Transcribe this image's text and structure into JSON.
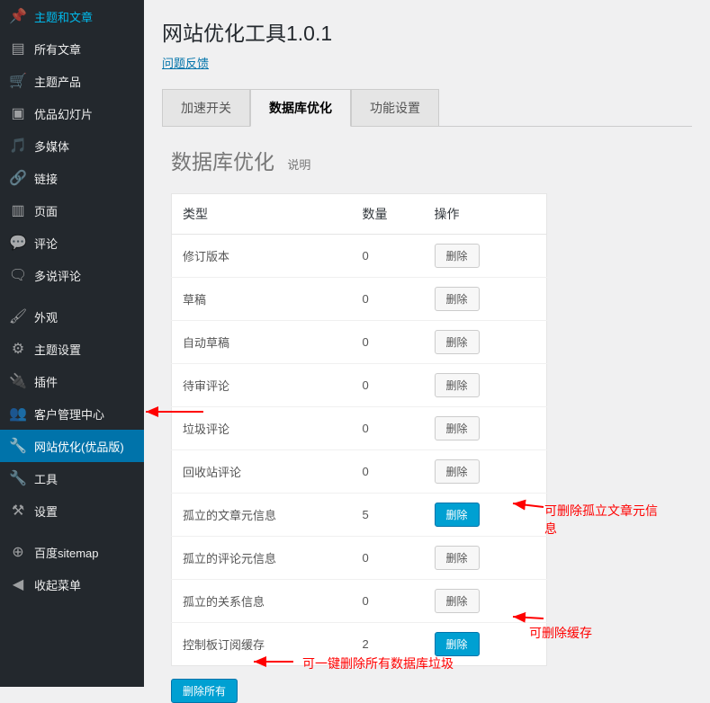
{
  "sidebar": {
    "items": [
      {
        "label": "主题和文章",
        "icon": "pin"
      },
      {
        "label": "所有文章",
        "icon": "list"
      },
      {
        "label": "主题产品",
        "icon": "cart"
      },
      {
        "label": "优品幻灯片",
        "icon": "slide"
      },
      {
        "label": "多媒体",
        "icon": "media"
      },
      {
        "label": "链接",
        "icon": "link"
      },
      {
        "label": "页面",
        "icon": "page"
      },
      {
        "label": "评论",
        "icon": "comment"
      },
      {
        "label": "多说评论",
        "icon": "chat"
      },
      {
        "label": "外观",
        "icon": "brush"
      },
      {
        "label": "主题设置",
        "icon": "gear"
      },
      {
        "label": "插件",
        "icon": "plugin"
      },
      {
        "label": "客户管理中心",
        "icon": "users"
      },
      {
        "label": "网站优化(优品版)",
        "icon": "wrench"
      },
      {
        "label": "工具",
        "icon": "wrench2"
      },
      {
        "label": "设置",
        "icon": "sliders"
      },
      {
        "label": "百度sitemap",
        "icon": "baidu"
      },
      {
        "label": "收起菜单",
        "icon": "collapse"
      }
    ],
    "active_index": 13
  },
  "header": {
    "title": "网站优化工具1.0.1",
    "feedback": "问题反馈"
  },
  "tabs": [
    {
      "label": "加速开关"
    },
    {
      "label": "数据库优化"
    },
    {
      "label": "功能设置"
    }
  ],
  "active_tab": 1,
  "section": {
    "title": "数据库优化",
    "hint": "说明"
  },
  "table": {
    "headers": [
      "类型",
      "数量",
      "操作"
    ],
    "rows": [
      {
        "type": "修订版本",
        "count": "0",
        "action": "删除",
        "primary": false
      },
      {
        "type": "草稿",
        "count": "0",
        "action": "删除",
        "primary": false
      },
      {
        "type": "自动草稿",
        "count": "0",
        "action": "删除",
        "primary": false
      },
      {
        "type": "待审评论",
        "count": "0",
        "action": "删除",
        "primary": false
      },
      {
        "type": "垃圾评论",
        "count": "0",
        "action": "删除",
        "primary": false
      },
      {
        "type": "回收站评论",
        "count": "0",
        "action": "删除",
        "primary": false
      },
      {
        "type": "孤立的文章元信息",
        "count": "5",
        "action": "删除",
        "primary": true
      },
      {
        "type": "孤立的评论元信息",
        "count": "0",
        "action": "删除",
        "primary": false
      },
      {
        "type": "孤立的关系信息",
        "count": "0",
        "action": "删除",
        "primary": false
      },
      {
        "type": "控制板订阅缓存",
        "count": "2",
        "action": "删除",
        "primary": true
      }
    ]
  },
  "delete_all": "删除所有",
  "annotations": {
    "a1": "可删除孤立文章元信息",
    "a2": "可删除缓存",
    "a3": "可一键删除所有数据库垃圾"
  }
}
